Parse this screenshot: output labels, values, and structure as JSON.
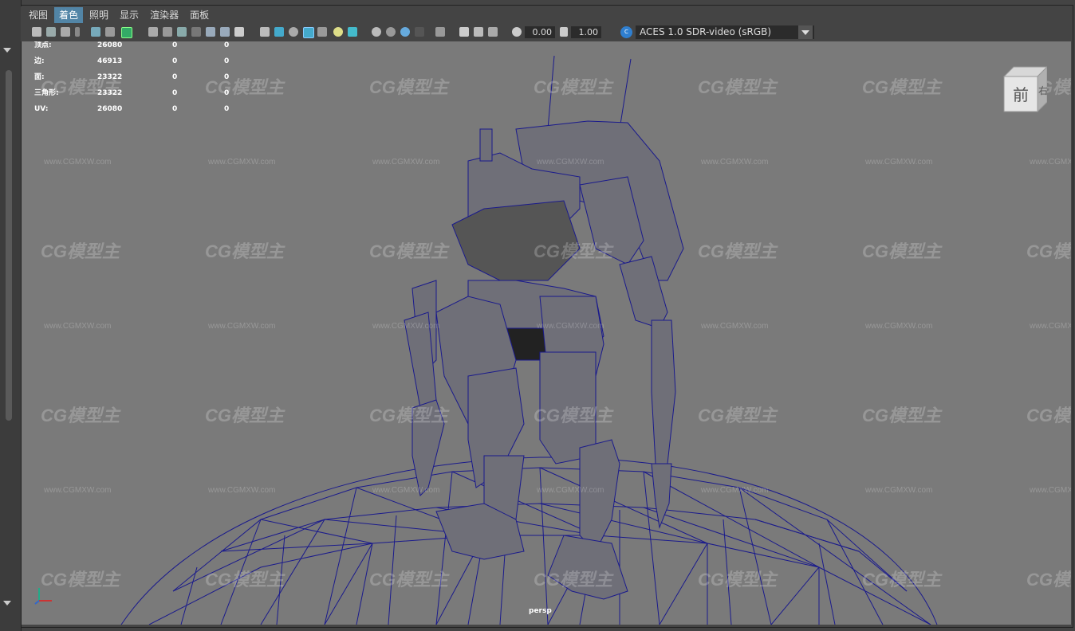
{
  "menu": {
    "items": [
      {
        "label": "视图",
        "active": false
      },
      {
        "label": "着色",
        "active": true
      },
      {
        "label": "照明",
        "active": false
      },
      {
        "label": "显示",
        "active": false
      },
      {
        "label": "渲染器",
        "active": false
      },
      {
        "label": "面板",
        "active": false
      }
    ]
  },
  "toolbar": {
    "exposure_value": "0.00",
    "gamma_value": "1.00",
    "color_space": "ACES 1.0 SDR-video (sRGB)"
  },
  "hud": {
    "rows": [
      {
        "label": "顶点:",
        "v1": "26080",
        "v2": "0",
        "v3": "0"
      },
      {
        "label": "边:",
        "v1": "46913",
        "v2": "0",
        "v3": "0"
      },
      {
        "label": "面:",
        "v1": "23322",
        "v2": "0",
        "v3": "0"
      },
      {
        "label": "三角形:",
        "v1": "23322",
        "v2": "0",
        "v3": "0"
      },
      {
        "label": "UV:",
        "v1": "26080",
        "v2": "0",
        "v3": "0"
      }
    ]
  },
  "viewport": {
    "camera_name": "persp",
    "view_cube_face": "前",
    "view_cube_side": "右",
    "watermark_logo": "CG模型主",
    "watermark_url": "www.CGMXW.com"
  },
  "colors": {
    "accent": "#5285a6",
    "wireframe": "#1a1a8c",
    "viewport_bg": "#7a7a7a"
  }
}
